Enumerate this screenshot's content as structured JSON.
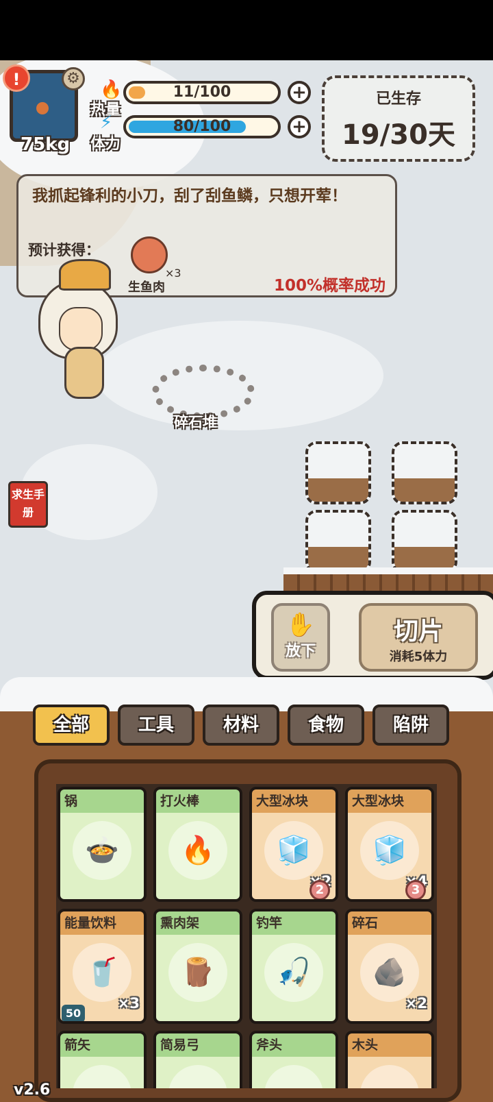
{
  "hud": {
    "weight": "75kg",
    "heat": {
      "label": "热量",
      "text": "11/100",
      "fraction": 0.11,
      "color": "#f2a64a"
    },
    "stamina": {
      "label": "体力",
      "text": "80/100",
      "fraction": 0.8,
      "color": "#2fa6e0"
    },
    "alert_icon": "exclamation-icon",
    "settings_icon": "gear-icon",
    "plus_glyph": "+",
    "survival": {
      "label": "已生存",
      "value": "19/30天"
    }
  },
  "dialog": {
    "message": "我抓起锋利的小刀，刮了刮鱼鳞，只想开荤！",
    "expected_label": "预计获得：",
    "reward_name": "生鱼肉",
    "reward_qty": "×3",
    "success_rate": "100%概率成功"
  },
  "scene": {
    "stone_pile_label": "碎石堆",
    "handbook_label": "求生手册"
  },
  "actions": {
    "put_down": "放下",
    "slice": "切片",
    "slice_cost": "消耗5体力"
  },
  "tabs": [
    "全部",
    "工具",
    "材料",
    "食物",
    "陷阱"
  ],
  "active_tab": "全部",
  "inventory": [
    {
      "name": "锅",
      "icon": "pot-icon",
      "glyph": "🍲",
      "theme": "green",
      "count": "",
      "badge": "",
      "chip": ""
    },
    {
      "name": "打火棒",
      "icon": "fire-stick-icon",
      "glyph": "🔥",
      "theme": "green",
      "count": "",
      "badge": "",
      "chip": ""
    },
    {
      "name": "大型冰块",
      "icon": "ice-block-icon",
      "glyph": "🧊",
      "theme": "orange",
      "count": "×2",
      "badge": "2",
      "chip": ""
    },
    {
      "name": "大型冰块",
      "icon": "ice-block-icon",
      "glyph": "🧊",
      "theme": "orange",
      "count": "×4",
      "badge": "3",
      "chip": ""
    },
    {
      "name": "能量饮料",
      "icon": "energy-drink-icon",
      "glyph": "🥤",
      "theme": "orange",
      "count": "×3",
      "badge": "",
      "chip": "50"
    },
    {
      "name": "熏肉架",
      "icon": "smoking-rack-icon",
      "glyph": "🪵",
      "theme": "green",
      "count": "",
      "badge": "",
      "chip": ""
    },
    {
      "name": "钓竿",
      "icon": "fishing-rod-icon",
      "glyph": "🎣",
      "theme": "green",
      "count": "",
      "badge": "",
      "chip": ""
    },
    {
      "name": "碎石",
      "icon": "rock-icon",
      "glyph": "🪨",
      "theme": "orange",
      "count": "×2",
      "badge": "",
      "chip": ""
    },
    {
      "name": "箭矢",
      "icon": "arrow-icon",
      "glyph": "",
      "theme": "green",
      "count": "",
      "badge": "",
      "chip": ""
    },
    {
      "name": "简易弓",
      "icon": "bow-icon",
      "glyph": "",
      "theme": "green",
      "count": "",
      "badge": "",
      "chip": ""
    },
    {
      "name": "斧头",
      "icon": "axe-icon",
      "glyph": "",
      "theme": "green",
      "count": "",
      "badge": "",
      "chip": ""
    },
    {
      "name": "木头",
      "icon": "wood-icon",
      "glyph": "",
      "theme": "orange",
      "count": "",
      "badge": "",
      "chip": ""
    }
  ],
  "version": "v2.6"
}
